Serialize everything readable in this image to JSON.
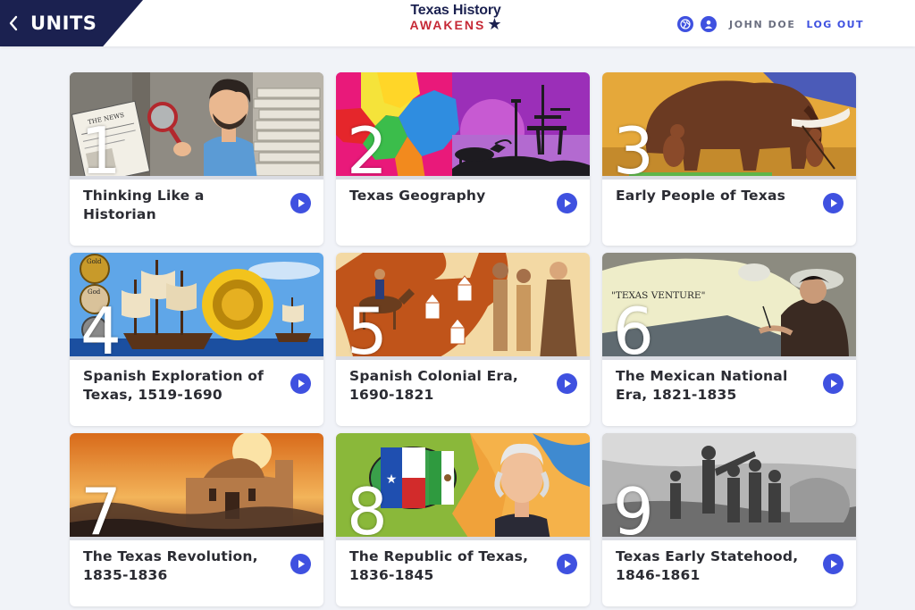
{
  "header": {
    "title": "UNITS",
    "back_icon": "chevron-left-icon",
    "logo_line1": "Texas History",
    "logo_line2": "AWAKENS",
    "user_name": "JOHN DOE",
    "logout_label": "LOG OUT",
    "globe_icon": "globe-icon",
    "user_icon": "user-circle-icon"
  },
  "colors": {
    "header_bg": "#1b2150",
    "accent": "#3f51e0",
    "logo_red": "#c62936",
    "page_bg": "#f1f3f8"
  },
  "units": [
    {
      "number": "1",
      "title": "Thinking Like a Historian"
    },
    {
      "number": "2",
      "title": "Texas Geography"
    },
    {
      "number": "3",
      "title": "Early People of Texas"
    },
    {
      "number": "4",
      "title": "Spanish Exploration of Texas, 1519-1690"
    },
    {
      "number": "5",
      "title": "Spanish Colonial Era, 1690-1821"
    },
    {
      "number": "6",
      "title": "The Mexican National Era, 1821-1835"
    },
    {
      "number": "7",
      "title": "The Texas Revolution, 1835-1836"
    },
    {
      "number": "8",
      "title": "The Republic of Texas, 1836-1845"
    },
    {
      "number": "9",
      "title": "Texas Early Statehood, 1846-1861"
    }
  ],
  "image_text": {
    "news_headline": "THE NEWS",
    "coin_gold": "Gold",
    "coin_god": "God",
    "venture_banner": "\"TEXAS VENTURE\""
  }
}
